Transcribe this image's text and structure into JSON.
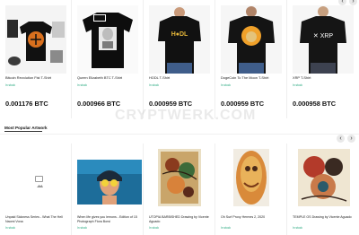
{
  "colors": {
    "accent": "#1fa67a",
    "price": "#111111"
  },
  "carousel_top": {
    "prev": "‹",
    "next": "›"
  },
  "products": [
    {
      "name": "Bitcoin Revolution Fist T-Shirt",
      "stock": "In stock",
      "price": "0.001176 BTC",
      "icon": "black-tshirt-product-photo"
    },
    {
      "name": "Queen Elizabeth BTC T-Shirt",
      "stock": "In stock",
      "price": "0.000966 BTC",
      "icon": "black-tshirt-product-photo"
    },
    {
      "name": "HODL T-Shirt",
      "stock": "In stock",
      "price": "0.000959 BTC",
      "icon": "model-tshirt-photo"
    },
    {
      "name": "DogeCoin To The Moon T-Shirt",
      "stock": "In stock",
      "price": "0.000959 BTC",
      "icon": "model-tshirt-photo"
    },
    {
      "name": "XRP T-Shirt",
      "stock": "In stock",
      "price": "0.000958 BTC",
      "icon": "model-tshirt-photo"
    }
  ],
  "watermark": "CRYPTWERK.COM",
  "art_section": {
    "title": "Most Popular Artwork",
    "prev": "‹",
    "next": "›"
  },
  "artworks": [
    {
      "name": "Unpaid Sickness Series - What The Hell Naomi Vona",
      "stock": "In stock"
    },
    {
      "name": "When life gives you lemons - Edition of 15 Photograph Flora Borsi",
      "stock": "In stock"
    },
    {
      "name": "UTOPIA BARBISHED Drawing by Vicente Aguado",
      "stock": "In stock"
    },
    {
      "name": "Oh Surf Proxy Hermes 2, 2020",
      "stock": "In stock"
    },
    {
      "name": "TEMPLE OS Drawing by Vicente Aguado",
      "stock": "In stock"
    }
  ]
}
